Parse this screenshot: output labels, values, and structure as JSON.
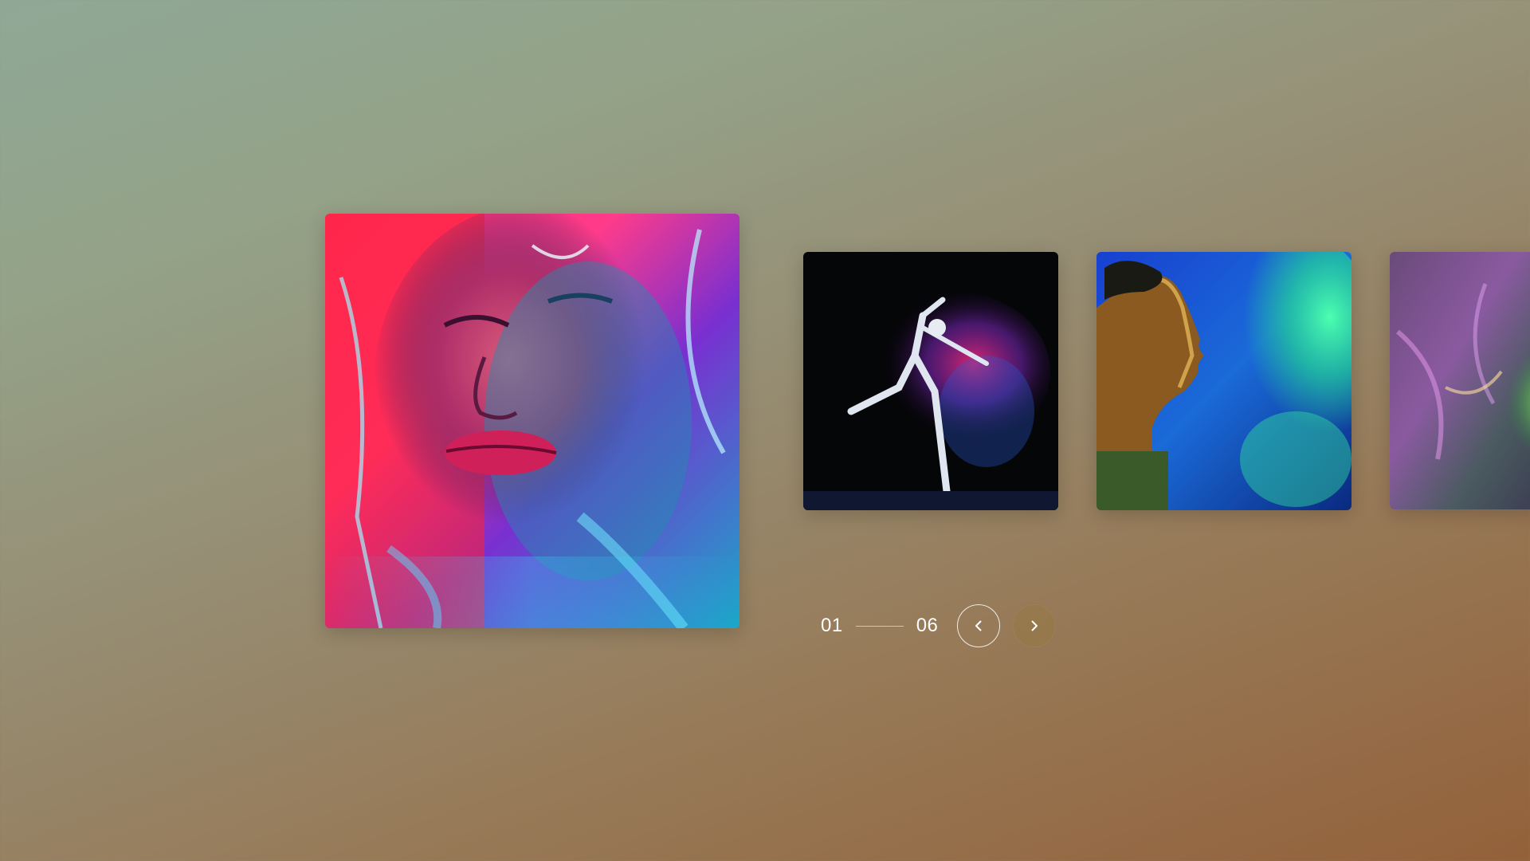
{
  "slides": [
    {
      "name": "slide-main",
      "subject": "woman-face-in-iridescent-plastic",
      "active": true
    },
    {
      "name": "slide-2",
      "subject": "dancer-with-motion-blur"
    },
    {
      "name": "slide-3",
      "subject": "man-profile-with-colored-smoke"
    },
    {
      "name": "slide-4",
      "subject": "iridescent-abstract-texture"
    }
  ],
  "pager": {
    "current": "01",
    "total": "06"
  },
  "nav": {
    "prev_icon": "chevron-left-icon",
    "next_icon": "chevron-right-icon"
  },
  "colors": {
    "text": "#ffffff",
    "next_button_fill": "#96784680"
  }
}
